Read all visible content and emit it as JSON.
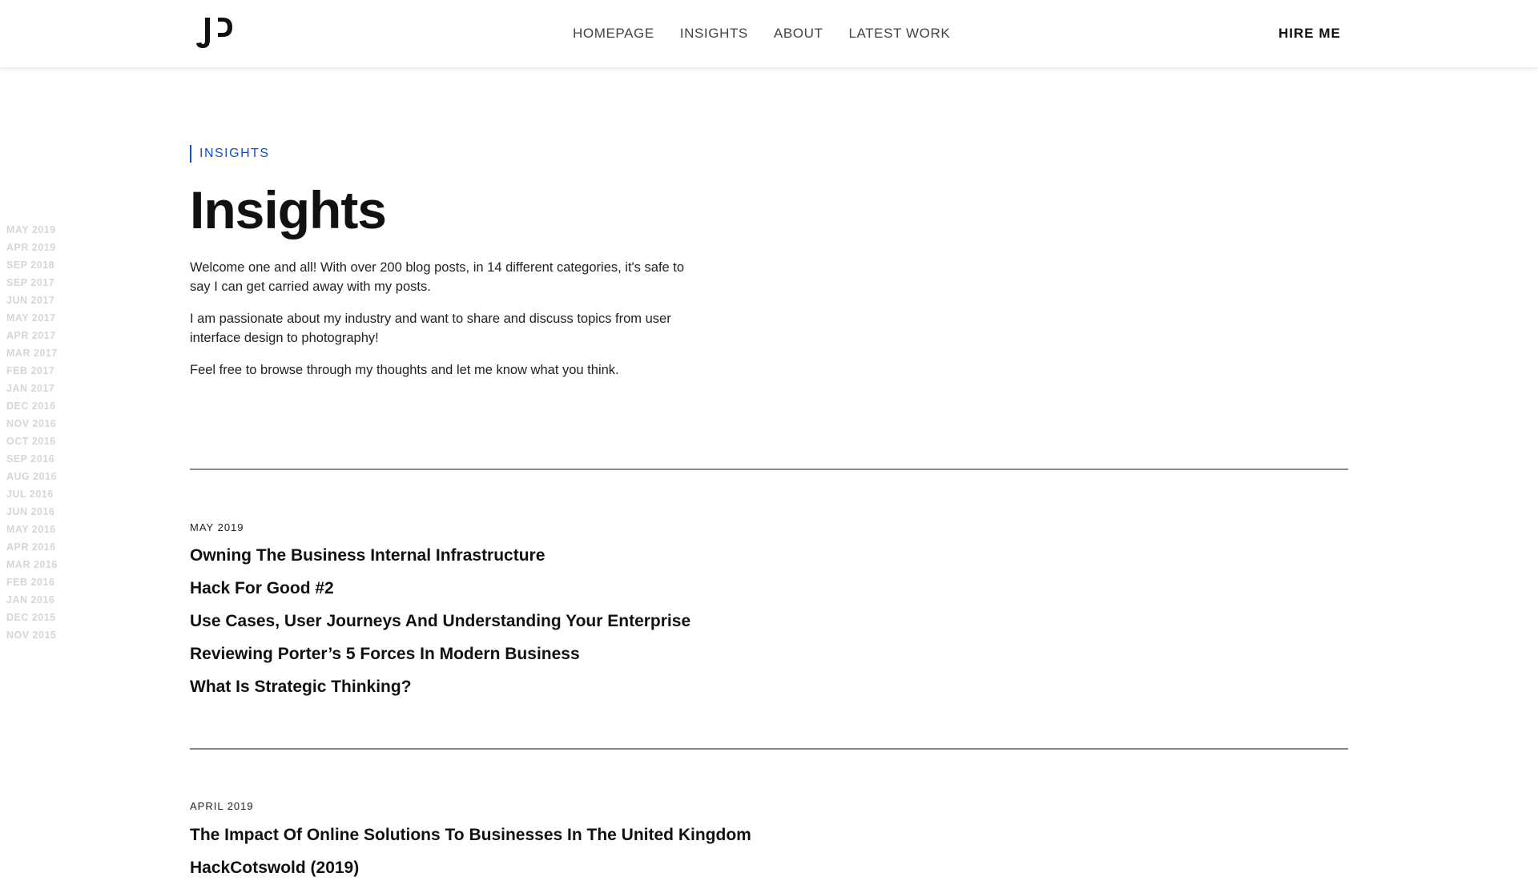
{
  "header": {
    "logo_text": "JP",
    "nav": [
      {
        "label": "HOMEPAGE"
      },
      {
        "label": "INSIGHTS"
      },
      {
        "label": "ABOUT"
      },
      {
        "label": "LATEST WORK"
      }
    ],
    "cta_label": "HIRE ME"
  },
  "archive": [
    "MAY 2019",
    "APR 2019",
    "SEP 2018",
    "SEP 2017",
    "JUN 2017",
    "MAY 2017",
    "APR 2017",
    "MAR 2017",
    "FEB 2017",
    "JAN 2017",
    "DEC 2016",
    "NOV 2016",
    "OCT 2016",
    "SEP 2016",
    "AUG 2016",
    "JUL 2016",
    "JUN 2016",
    "MAY 2016",
    "APR 2016",
    "MAR 2016",
    "FEB 2016",
    "JAN 2016",
    "DEC 2015",
    "NOV 2015"
  ],
  "main": {
    "eyebrow": "INSIGHTS",
    "title": "Insights",
    "intro": [
      "Welcome one and all! With over 200 blog posts, in 14 different categories, it's safe to say I can get carried away with my posts.",
      "I am passionate about my industry and want to share and discuss topics from user interface design to photography!",
      "Feel free to browse through my thoughts and let me know what you think."
    ],
    "sections": [
      {
        "month": "MAY 2019",
        "posts": [
          "Owning The Business Internal Infrastructure",
          "Hack For Good #2",
          "Use Cases, User Journeys And Understanding Your Enterprise",
          "Reviewing Porter’s 5 Forces In Modern Business",
          "What Is Strategic Thinking?"
        ]
      },
      {
        "month": "APRIL 2019",
        "posts": [
          "The Impact Of Online Solutions To Businesses In The United Kingdom",
          "HackCotswold (2019)"
        ]
      }
    ]
  },
  "colors": {
    "accent": "#1250c8",
    "archive_text": "#d6d6d6",
    "divider": "#888888"
  }
}
